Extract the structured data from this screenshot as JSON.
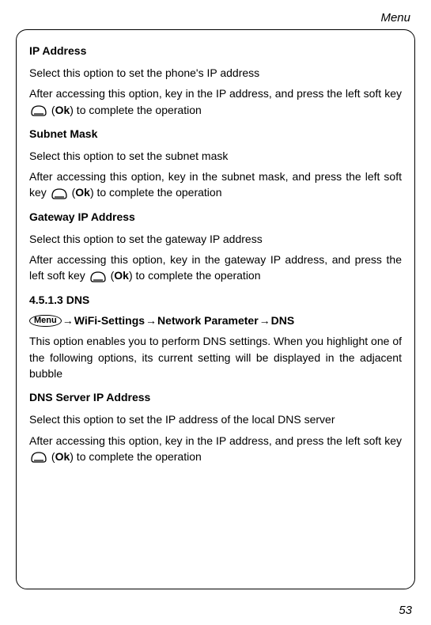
{
  "header": {
    "title": "Menu"
  },
  "sections": {
    "ip_address": {
      "heading": "IP Address",
      "p1": "Select this option to set the phone's IP address",
      "p2a": "After accessing this option, key in the IP address, and press the left soft key ",
      "p2b_open": " (",
      "p2b_ok": "Ok",
      "p2b_close": ") to complete the operation"
    },
    "subnet_mask": {
      "heading": "Subnet Mask",
      "p1": "Select this option to set the subnet mask",
      "p2a": "After accessing this option, key in the subnet mask, and press the left soft key ",
      "p2b_open": " (",
      "p2b_ok": "Ok",
      "p2b_close": ") to complete the operation"
    },
    "gateway": {
      "heading": "Gateway IP Address",
      "p1": "Select this option to set the gateway IP address",
      "p2a": "After accessing this option, key in the gateway IP address, and press the left soft key ",
      "p2b_open": " (",
      "p2b_ok": "Ok",
      "p2b_close": ") to complete the operation"
    },
    "dns": {
      "heading": "4.5.1.3 DNS",
      "menu_label": "Menu",
      "nav1": "WiFi-Settings",
      "nav2": "Network Parameter",
      "nav3": "DNS",
      "arrow": "→",
      "p1": "This option enables you to perform DNS settings. When you highlight one of the following options, its current setting will be displayed in the adjacent bubble"
    },
    "dns_server": {
      "heading": "DNS Server IP Address",
      "p1": "Select this option to set the IP address of the local DNS server",
      "p2a": "After accessing this option, key in the IP address, and press the left soft key ",
      "p2b_open": " (",
      "p2b_ok": "Ok",
      "p2b_close": ") to complete the operation"
    }
  },
  "page_number": "53"
}
